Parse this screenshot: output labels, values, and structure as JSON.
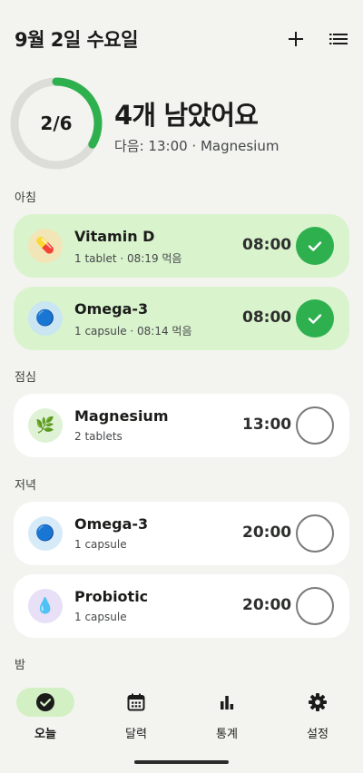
{
  "header": {
    "date": "9월 2일 수요일",
    "add_icon": "plus-icon",
    "list_icon": "list-icon"
  },
  "summary": {
    "count": "2/6",
    "progress": 0.3333,
    "remaining": "4개 남았어요",
    "next": "다음: 13:00 · Magnesium",
    "ring_color": "#2fb04f",
    "track_color": "#dcdcd8"
  },
  "sections": {
    "morning": "아침",
    "noon": "점심",
    "evening": "저녁",
    "night": "밤"
  },
  "meds": [
    {
      "name": "Vitamin D",
      "sub": "1 tablet · 08:19 먹음",
      "time": "08:00",
      "icon": "pill-icon",
      "glyph": "💊",
      "taken": true
    },
    {
      "name": "Omega-3",
      "sub": "1 capsule · 08:14 먹음",
      "time": "08:00",
      "icon": "capsule-icon",
      "glyph": "🔵",
      "taken": true
    },
    {
      "name": "Magnesium",
      "sub": "2 tablets",
      "time": "13:00",
      "icon": "herb-icon",
      "glyph": "🌿",
      "taken": false
    },
    {
      "name": "Omega-3",
      "sub": "1 capsule",
      "time": "20:00",
      "icon": "capsule-icon",
      "glyph": "🔵",
      "taken": false
    },
    {
      "name": "Probiotic",
      "sub": "1 capsule",
      "time": "20:00",
      "icon": "droplet-icon",
      "glyph": "💧",
      "taken": false
    }
  ],
  "nav": {
    "today": "오늘",
    "calendar": "달력",
    "stats": "통계",
    "settings": "설정"
  },
  "colors": {
    "taken_card": "#d9f3cd",
    "accent_green": "#2fb04f",
    "background": "#f3f4ef"
  }
}
